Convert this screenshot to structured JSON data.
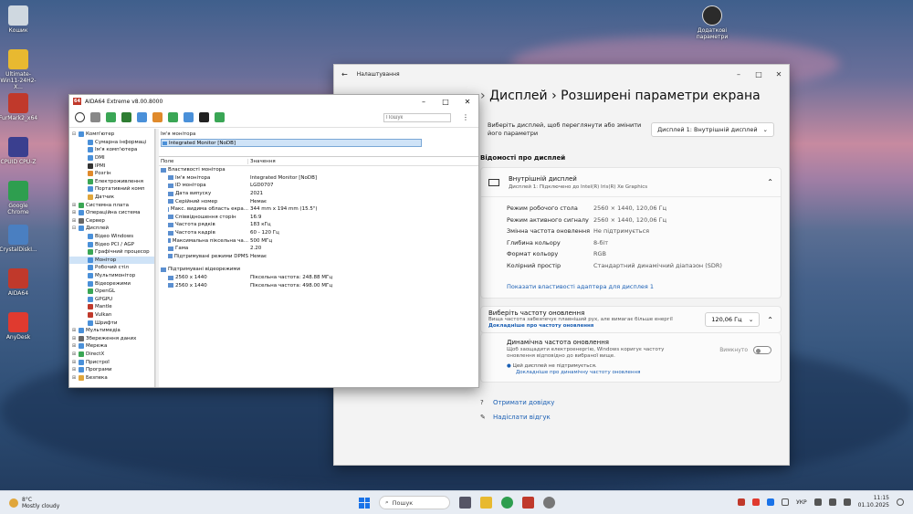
{
  "desktop": {
    "icons": [
      {
        "label": "Кошик",
        "icon": "recycle-bin-icon",
        "color": "#cfd8e0"
      },
      {
        "label": "Ultimate-Win11-24H2-X...",
        "icon": "folder-icon",
        "color": "#e8b930"
      },
      {
        "label": "FurMark2_x64",
        "icon": "furmark-icon",
        "color": "#c0392b"
      },
      {
        "label": "CPUID CPU-Z",
        "icon": "cpuz-icon",
        "color": "#3a3f8f"
      },
      {
        "label": "Google Chrome",
        "icon": "chrome-icon",
        "color": "#2e9e4f"
      },
      {
        "label": "CrystalDiskI...",
        "icon": "crystaldisk-icon",
        "color": "#4a7fc1"
      },
      {
        "label": "AIDA64",
        "icon": "aida64-icon",
        "color": "#c0392b"
      },
      {
        "label": "AnyDesk",
        "icon": "anydesk-icon",
        "color": "#e03a2f"
      }
    ],
    "right_icon_label": "Додаткові параметри"
  },
  "settings": {
    "title": "Налаштування",
    "breadcrumb": {
      "part1": "Дисплей",
      "sep": "›",
      "part2": "Розширені параметри екрана",
      "lead": "› "
    },
    "choose_text": "Виберіть дисплей, щоб переглянути або змінити його параметри",
    "choose_value": "Дисплей 1: Внутрішній дисплей",
    "section_title": "Відомості про дисплей",
    "display_name": "Внутрішній дисплей",
    "display_sub": "Дисплей 1: Підключено до Intel(R) Iris(R) Xe Graphics",
    "props": [
      {
        "k": "Режим робочого стола",
        "v": "2560 × 1440, 120,06 Гц"
      },
      {
        "k": "Режим активного сигналу",
        "v": "2560 × 1440, 120,06 Гц"
      },
      {
        "k": "Змінна частота оновлення",
        "v": "Не підтримується"
      },
      {
        "k": "Глибина кольору",
        "v": "8-біт"
      },
      {
        "k": "Формат кольору",
        "v": "RGB"
      },
      {
        "k": "Колірний простір",
        "v": "Стандартний динамічний діапазон (SDR)"
      }
    ],
    "adapter_link": "Показати властивості адаптера для дисплея 1",
    "refresh_title": "Виберіть частоту оновлення",
    "refresh_desc": "Вища частота забезпечує плавніший рух, але вимагає більше енергії",
    "refresh_more": "Докладніше про частоту оновлення",
    "refresh_value": "120,06 Гц",
    "dyn_title": "Динамічна частота оновлення",
    "dyn_desc": "Щоб заощадити електроенергію, Windows коригує частоту оновлення відповідно до вибраної вище.",
    "dyn_info": "Цей дисплей не підтримується.",
    "dyn_link": "Докладніше про динамічну частоту оновлення",
    "dyn_state": "Вимкнуто",
    "help1": "Отримати довідку",
    "help2": "Надіслати відгук"
  },
  "aida": {
    "title": "AIDA64 Extreme v8.00.8000",
    "search_placeholder": "Пошук",
    "toolbar_icons": [
      "refresh-icon",
      "report-icon",
      "memory-icon",
      "motherboard-icon",
      "network-icon",
      "flame-icon",
      "graph-icon",
      "user-icon",
      "osd-icon",
      "gauge-icon"
    ],
    "tree": [
      {
        "label": "Комп'ютер",
        "lvl": 0,
        "ex": "⊟",
        "color": "#4a90d9"
      },
      {
        "label": "Сумарна інформаці",
        "lvl": 1,
        "ex": "",
        "color": "#4a90d9"
      },
      {
        "label": "Ім'я комп'ютера",
        "lvl": 1,
        "ex": "",
        "color": "#4a90d9"
      },
      {
        "label": "DMI",
        "lvl": 1,
        "ex": "",
        "color": "#4a90d9"
      },
      {
        "label": "IPMI",
        "lvl": 1,
        "ex": "",
        "color": "#333333"
      },
      {
        "label": "Розгін",
        "lvl": 1,
        "ex": "",
        "color": "#e08a2b"
      },
      {
        "label": "Електроживлення",
        "lvl": 1,
        "ex": "",
        "color": "#3aa655"
      },
      {
        "label": "Портативний комп",
        "lvl": 1,
        "ex": "",
        "color": "#4a90d9"
      },
      {
        "label": "Датчик",
        "lvl": 1,
        "ex": "",
        "color": "#e0a63b"
      },
      {
        "label": "Системна плата",
        "lvl": 0,
        "ex": "⊞",
        "color": "#3aa655"
      },
      {
        "label": "Операційна система",
        "lvl": 0,
        "ex": "⊞",
        "color": "#4a90d9"
      },
      {
        "label": "Сервер",
        "lvl": 0,
        "ex": "⊞",
        "color": "#666666"
      },
      {
        "label": "Дисплей",
        "lvl": 0,
        "ex": "⊟",
        "color": "#4a90d9"
      },
      {
        "label": "Відео Windows",
        "lvl": 1,
        "ex": "",
        "color": "#4a90d9"
      },
      {
        "label": "Відео PCI / AGP",
        "lvl": 1,
        "ex": "",
        "color": "#4a90d9"
      },
      {
        "label": "Графічний процесор",
        "lvl": 1,
        "ex": "",
        "color": "#3aa655"
      },
      {
        "label": "Монітор",
        "lvl": 1,
        "ex": "",
        "color": "#4a90d9",
        "sel": true
      },
      {
        "label": "Робочий стіл",
        "lvl": 1,
        "ex": "",
        "color": "#4a90d9"
      },
      {
        "label": "Мультимонітор",
        "lvl": 1,
        "ex": "",
        "color": "#4a90d9"
      },
      {
        "label": "Відеорежими",
        "lvl": 1,
        "ex": "",
        "color": "#4a90d9"
      },
      {
        "label": "OpenGL",
        "lvl": 1,
        "ex": "",
        "color": "#3aa655"
      },
      {
        "label": "GPGPU",
        "lvl": 1,
        "ex": "",
        "color": "#4a90d9"
      },
      {
        "label": "Mantle",
        "lvl": 1,
        "ex": "",
        "color": "#c0392b"
      },
      {
        "label": "Vulkan",
        "lvl": 1,
        "ex": "",
        "color": "#c0392b"
      },
      {
        "label": "Шрифти",
        "lvl": 1,
        "ex": "",
        "color": "#4a90d9"
      },
      {
        "label": "Мультимедіа",
        "lvl": 0,
        "ex": "⊞",
        "color": "#4a90d9"
      },
      {
        "label": "Збереження даних",
        "lvl": 0,
        "ex": "⊞",
        "color": "#666666"
      },
      {
        "label": "Мережа",
        "lvl": 0,
        "ex": "⊞",
        "color": "#4a90d9"
      },
      {
        "label": "DirectX",
        "lvl": 0,
        "ex": "⊞",
        "color": "#3aa655"
      },
      {
        "label": "Пристрої",
        "lvl": 0,
        "ex": "⊞",
        "color": "#4a90d9"
      },
      {
        "label": "Програми",
        "lvl": 0,
        "ex": "⊞",
        "color": "#4a90d9"
      },
      {
        "label": "Безпека",
        "lvl": 0,
        "ex": "⊞",
        "color": "#e0a63b"
      }
    ],
    "detail_label": "Ім'я монітора",
    "detail_selected": "Integrated Monitor [NoDB]",
    "col_field": "Поле",
    "col_value": "Значення",
    "rows": [
      {
        "k": "Властивості монітора",
        "v": "",
        "t": "grp"
      },
      {
        "k": "Ім'я монітора",
        "v": "Integrated Monitor [NoDB]",
        "t": "sub"
      },
      {
        "k": "ID монітора",
        "v": "LGD0707",
        "t": "sub"
      },
      {
        "k": "Дата випуску",
        "v": "2021",
        "t": "sub"
      },
      {
        "k": "Серійний номер",
        "v": "Немає",
        "t": "sub"
      },
      {
        "k": "Макс. видима область екра...",
        "v": "344 mm x 194 mm (15.5\")",
        "t": "sub"
      },
      {
        "k": "Співвідношення сторін",
        "v": "16:9",
        "t": "sub"
      },
      {
        "k": "Частота рядків",
        "v": "183 кГц",
        "t": "sub"
      },
      {
        "k": "Частота кадрів",
        "v": "60 - 120 Гц",
        "t": "sub"
      },
      {
        "k": "Максимальна піксельна ча...",
        "v": "500 МГц",
        "t": "sub"
      },
      {
        "k": "Гама",
        "v": "2.20",
        "t": "sub"
      },
      {
        "k": "Підтримувані режими DPMS",
        "v": "Немає",
        "t": "sub"
      },
      {
        "k": "",
        "v": "",
        "t": "gap"
      },
      {
        "k": "Підтримувані відеорежими",
        "v": "",
        "t": "grp"
      },
      {
        "k": "2560 x 1440",
        "v": "Піксельна частота: 248.88 МГц",
        "t": "sub"
      },
      {
        "k": "2560 x 1440",
        "v": "Піксельна частота: 498.00 МГц",
        "t": "sub"
      }
    ]
  },
  "taskbar": {
    "temp": "8°C",
    "weather": "Mostly cloudy",
    "search": "Пошук",
    "lang": "УКР",
    "time": "11:15",
    "date": "01.10.2025"
  }
}
